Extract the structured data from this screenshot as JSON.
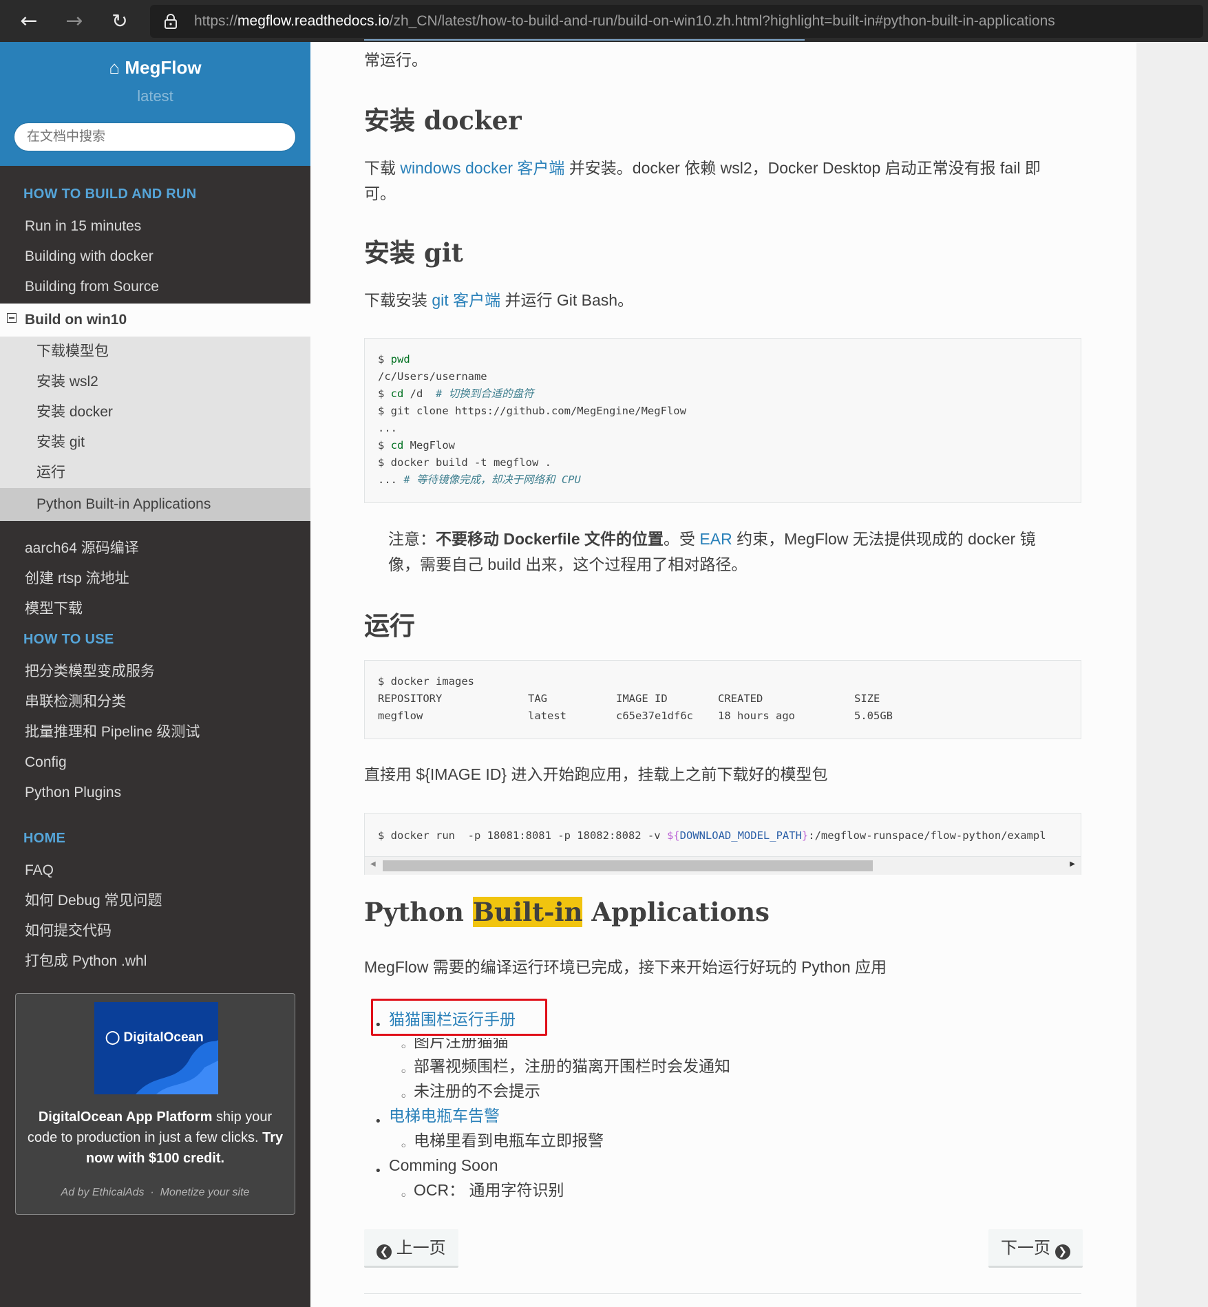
{
  "browser": {
    "url_prefix": "https://",
    "url_host": "megflow.readthedocs.io",
    "url_path": "/zh_CN/latest/how-to-build-and-run/build-on-win10.zh.html?highlight=built-in#python-built-in-applications"
  },
  "sidebar": {
    "brand": "MegFlow",
    "version": "latest",
    "search_placeholder": "在文档中搜索",
    "caption1": "HOW TO BUILD AND RUN",
    "items1": [
      "Run in 15 minutes",
      "Building with docker",
      "Building from Source"
    ],
    "current": "Build on win10",
    "subitems": [
      "下载模型包",
      "安装 wsl2",
      "安装 docker",
      "安装 git",
      "运行",
      "Python Built-in Applications"
    ],
    "items1b": [
      "aarch64 源码编译",
      "创建 rtsp 流地址",
      "模型下载"
    ],
    "caption2": "HOW TO USE",
    "items2": [
      "把分类模型变成服务",
      "串联检测和分类",
      "批量推理和 Pipeline 级测试",
      "Config",
      "Python Plugins"
    ],
    "caption3": "HOME",
    "items3": [
      "FAQ",
      "如何 Debug 常见问题",
      "如何提交代码",
      "打包成 Python .whl"
    ]
  },
  "ad": {
    "logo": "DigitalOcean",
    "text_bold1": "DigitalOcean App Platform",
    "text1": " ship your code to production in just a few clicks. ",
    "text_bold2": "Try now with $100 credit.",
    "by": "Ad by EthicalAds",
    "sep": "·",
    "monetize": "Monetize your site"
  },
  "content": {
    "top_fragment": "常运行。",
    "h_docker": "安装 docker",
    "p_docker_pre": "下载 ",
    "p_docker_link": "windows docker 客户端",
    "p_docker_post": " 并安装。docker 依赖 wsl2，Docker Desktop 启动正常没有报 fail 即可。",
    "h_git": "安装 git",
    "p_git_pre": "下载安装 ",
    "p_git_link": "git 客户端",
    "p_git_post": " 并运行 Git Bash。",
    "code1": {
      "l1_a": "$ ",
      "l1_kw": "pwd",
      "l2": "/c/Users/username",
      "l3_a": "$ ",
      "l3_kw": "cd",
      "l3_b": " /d  ",
      "l3_cm": "# 切换到合适的盘符",
      "l4": "$ git clone https://github.com/MegEngine/MegFlow",
      "l5": "...",
      "l6_a": "$ ",
      "l6_kw": "cd",
      "l6_b": " MegFlow",
      "l7": "$ docker build -t megflow .",
      "l8_a": "... ",
      "l8_cm": "# 等待镜像完成，却决于网络和 CPU"
    },
    "note_pre": "注意：",
    "note_bold": "不要移动 Dockerfile 文件的位置",
    "note_mid": "。受 ",
    "note_link": "EAR",
    "note_post": " 约束，MegFlow 无法提供现成的 docker 镜像，需要自己 build 出来，这个过程用了相对路径。",
    "h_run": "运行",
    "code2": {
      "l1": "$ docker images",
      "headers": [
        "REPOSITORY",
        "TAG",
        "IMAGE ID",
        "CREATED",
        "SIZE"
      ],
      "row": [
        "megflow",
        "latest",
        "c65e37e1df6c",
        "18 hours ago",
        "5.05GB"
      ]
    },
    "p_run": "直接用 ${IMAGE ID} 进入开始跑应用，挂载上之前下载好的模型包",
    "code3": {
      "a": "$ docker run  -p 18081:8081 -p 18082:8082 -v ",
      "var_open": "${",
      "var": "DOWNLOAD_MODEL_PATH",
      "var_close": "}",
      "b": ":/megflow-runspace/flow-python/exampl"
    },
    "h_py_1": "Python ",
    "h_py_hl": "Built-in",
    "h_py_2": " Applications",
    "p_py": "MegFlow 需要的编译运行环境已完成，接下来开始运行好玩的 Python 应用",
    "list": {
      "a1": "猫猫围栏运行手册",
      "a1_subs": [
        "图片注册猫猫",
        "部署视频围栏，注册的猫离开围栏时会发通知",
        "未注册的不会提示"
      ],
      "a2": "电梯电瓶车告警",
      "a2_subs": [
        "电梯里看到电瓶车立即报警"
      ],
      "a3": "Comming Soon",
      "a3_subs": [
        "OCR： 通用字符识别"
      ]
    },
    "prev": "上一页",
    "next": "下一页"
  },
  "colors": {
    "link": "#2980b9",
    "highlight": "#f1c40f",
    "sidebar_bg": "#343131",
    "brand_bg": "#2980b9",
    "annotation": "#e0101a"
  }
}
